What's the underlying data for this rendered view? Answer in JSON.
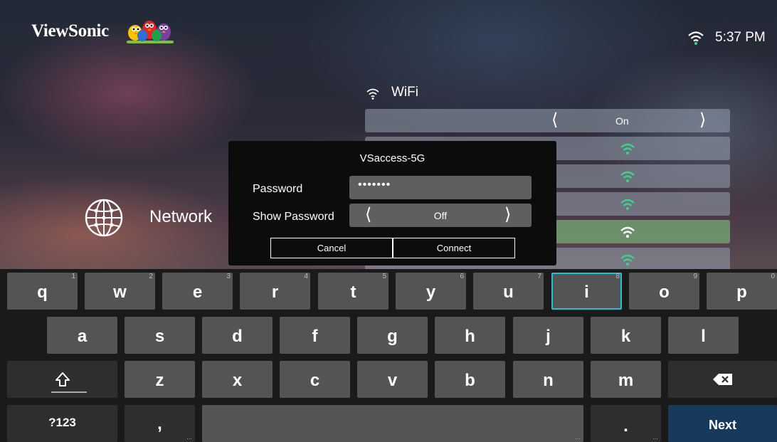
{
  "header": {
    "brand": "ViewSonic",
    "time": "5:37 PM",
    "status_icon": "wifi-signal-icon"
  },
  "wifi_panel": {
    "title": "WiFi",
    "toggle_value": "On",
    "networks_visible": 5
  },
  "sidebar": {
    "network_label": "Network"
  },
  "dialog": {
    "title": "VSaccess-5G",
    "password_label": "Password",
    "password_value": "•••••••",
    "show_password_label": "Show Password",
    "show_password_value": "Off",
    "cancel_label": "Cancel",
    "connect_label": "Connect"
  },
  "keyboard": {
    "row1": [
      {
        "key": "q",
        "alt": "1"
      },
      {
        "key": "w",
        "alt": "2"
      },
      {
        "key": "e",
        "alt": "3"
      },
      {
        "key": "r",
        "alt": "4"
      },
      {
        "key": "t",
        "alt": "5"
      },
      {
        "key": "y",
        "alt": "6"
      },
      {
        "key": "u",
        "alt": "7"
      },
      {
        "key": "i",
        "alt": "8"
      },
      {
        "key": "o",
        "alt": "9"
      },
      {
        "key": "p",
        "alt": "0"
      }
    ],
    "row2": [
      "a",
      "s",
      "d",
      "f",
      "g",
      "h",
      "j",
      "k",
      "l"
    ],
    "row3": [
      "z",
      "x",
      "c",
      "v",
      "b",
      "n",
      "m"
    ],
    "focused_key": "i",
    "shift_icon": "shift-arrow-icon",
    "backspace_icon": "backspace-icon",
    "symbols_label": "?123",
    "comma_label": ",",
    "period_label": ".",
    "next_label": "Next",
    "colors": {
      "focus": "#1fc3d6",
      "next": "#173a5c",
      "wifi_signal": "#3fd08a"
    }
  }
}
